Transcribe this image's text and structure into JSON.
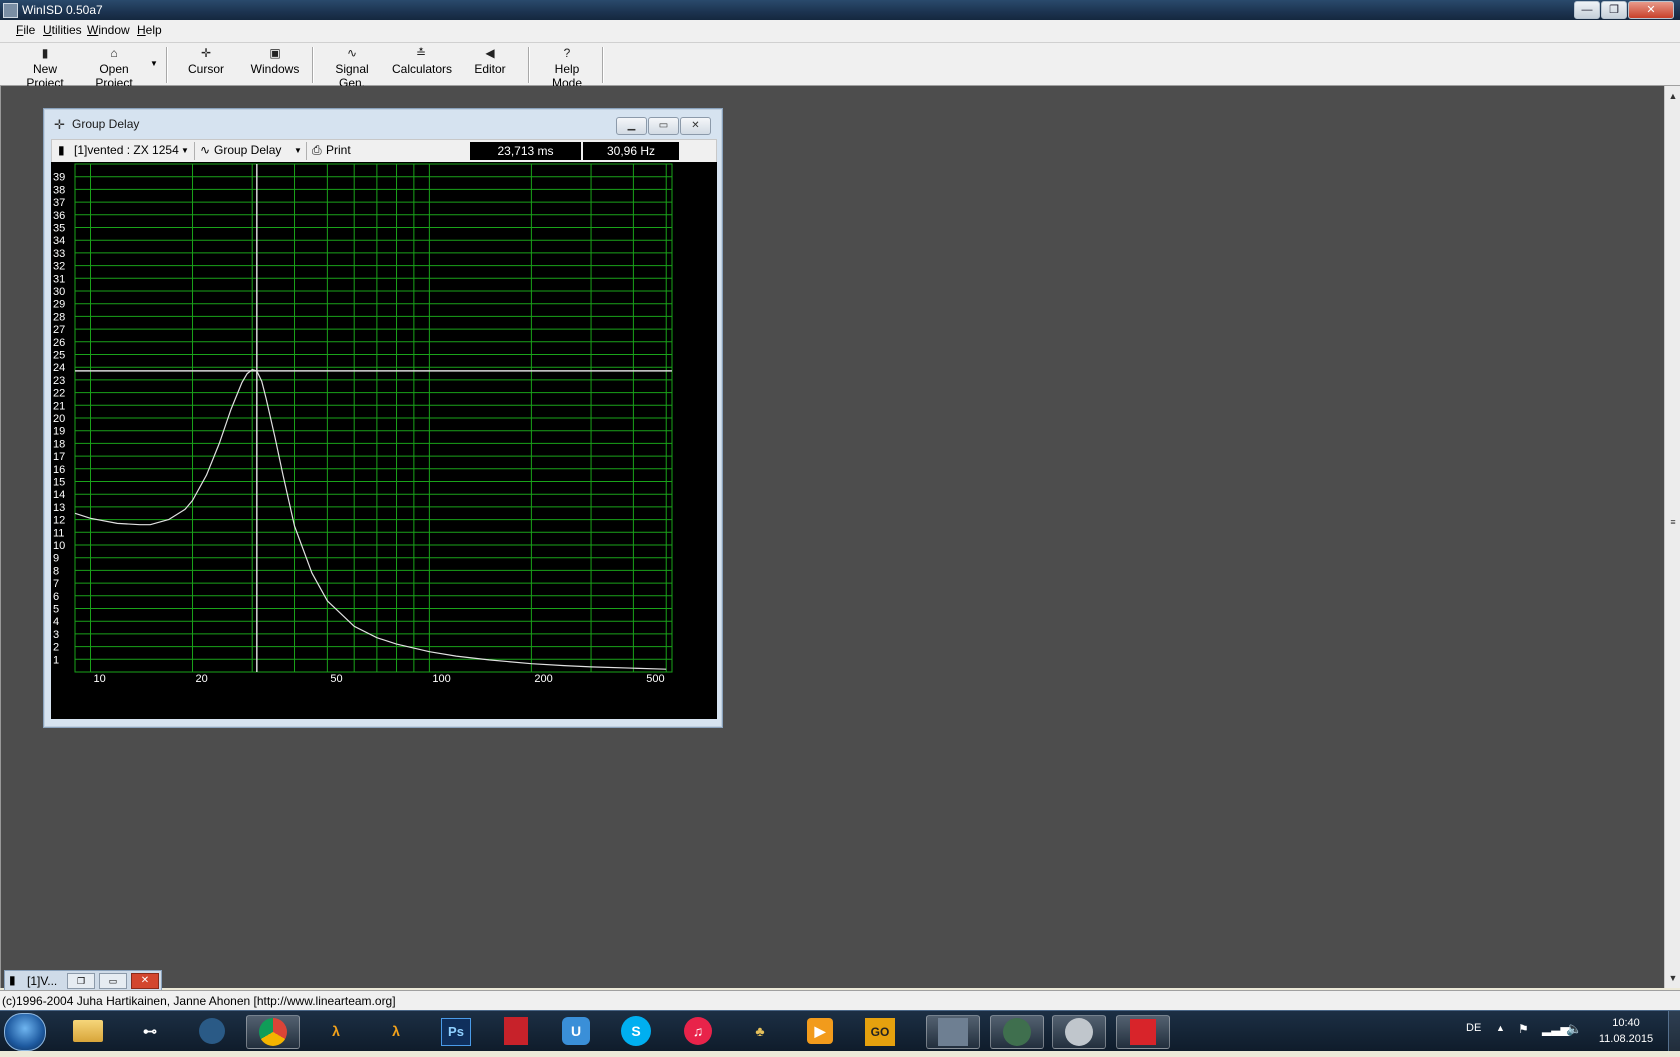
{
  "window": {
    "title": "WinISD 0.50a7",
    "btn_min": "—",
    "btn_max": "❐",
    "btn_close": "✕"
  },
  "menu": [
    {
      "u": "F",
      "rest": "ile"
    },
    {
      "u": "U",
      "rest": "tilities"
    },
    {
      "u": "W",
      "rest": "indow"
    },
    {
      "u": "H",
      "rest": "elp"
    }
  ],
  "toolbar": {
    "new_project": "New Project",
    "open_project": "Open Project",
    "cursor": "Cursor",
    "windows": "Windows",
    "signal_gen": "Signal Gen.",
    "calculators": "Calculators",
    "editor": "Editor",
    "help_mode": "Help Mode",
    "help_glyph": "?"
  },
  "child": {
    "title": "Group Delay",
    "project_select": "[1]vented : ZX 1254",
    "graph_select": "Group Delay",
    "print": "Print",
    "readout_ms": "23,713 ms",
    "readout_hz": "30,96 Hz"
  },
  "chart_data": {
    "type": "line",
    "title": "Group Delay",
    "xscale": "log",
    "xlim": [
      9,
      520
    ],
    "ylim": [
      0,
      40
    ],
    "x_ticks": [
      10,
      20,
      50,
      100,
      200,
      500
    ],
    "y_ticks": [
      1,
      2,
      3,
      4,
      5,
      6,
      7,
      8,
      9,
      10,
      11,
      12,
      13,
      14,
      15,
      16,
      17,
      18,
      19,
      20,
      21,
      22,
      23,
      24,
      25,
      26,
      27,
      28,
      29,
      30,
      31,
      32,
      33,
      34,
      35,
      36,
      37,
      38,
      39
    ],
    "grid": true,
    "grid_color": "#1aa31a",
    "line_color": "#e0e0e0",
    "cursor": {
      "x": 30.96,
      "y": 23.713
    },
    "series": [
      {
        "x": [
          9,
          10,
          12,
          14,
          15,
          17,
          19,
          20,
          22,
          24,
          26,
          28,
          29,
          30,
          30.96,
          32,
          33,
          35,
          37,
          40,
          45,
          50,
          60,
          70,
          80,
          100,
          120,
          150,
          200,
          250,
          300,
          400,
          500
        ],
        "values": [
          12.5,
          12.1,
          11.7,
          11.6,
          11.6,
          12.0,
          12.8,
          13.5,
          15.5,
          18.0,
          20.7,
          22.8,
          23.5,
          23.8,
          23.71,
          22.9,
          21.5,
          18.5,
          15.5,
          11.5,
          7.8,
          5.6,
          3.6,
          2.7,
          2.2,
          1.6,
          1.25,
          0.95,
          0.65,
          0.5,
          0.4,
          0.3,
          0.22
        ]
      }
    ]
  },
  "mdi_tab": {
    "label": "[1]V..."
  },
  "status": {
    "text": "(c)1996-2004 Juha Hartikainen, Janne Ahonen [http://www.linearteam.org]"
  },
  "taskbar": {
    "apps": [
      "start",
      "explorer",
      "steam-old",
      "steam",
      "chrome",
      "half-life-2-mmod",
      "half-life",
      "photoshop",
      "app-red",
      "uplay",
      "skype",
      "itunes",
      "app-tree",
      "media-player",
      "csgo",
      "winisd",
      "media-center",
      "speaker"
    ],
    "tray_lang": "DE",
    "time": "10:40",
    "date": "11.08.2015"
  }
}
